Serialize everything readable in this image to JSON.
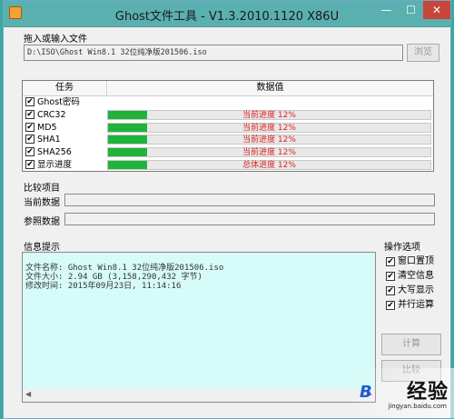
{
  "window": {
    "title": "Ghost文件工具 - V1.3.2010.1120 X86U",
    "min_glyph": "—",
    "max_glyph": "☐",
    "close_glyph": "✕"
  },
  "input_section": {
    "label": "拖入或输入文件",
    "path_value": "D:\\ISO\\Ghost Win8.1 32位纯净版201506.iso",
    "browse_label": "浏览"
  },
  "task_table": {
    "headers": {
      "task": "任务",
      "value": "数据值"
    },
    "rows": [
      {
        "name": "Ghost密码",
        "checked": true,
        "progress_text": "",
        "progress": 0
      },
      {
        "name": "CRC32",
        "checked": true,
        "progress_text": "当前进度 12%",
        "progress": 0.12
      },
      {
        "name": "MD5",
        "checked": true,
        "progress_text": "当前进度 12%",
        "progress": 0.12
      },
      {
        "name": "SHA1",
        "checked": true,
        "progress_text": "当前进度 12%",
        "progress": 0.12
      },
      {
        "name": "SHA256",
        "checked": true,
        "progress_text": "当前进度 12%",
        "progress": 0.12
      },
      {
        "name": "显示进度",
        "checked": true,
        "progress_text": "总体进度 12%",
        "progress": 0.12
      }
    ],
    "check_glyph": "✔",
    "progress_color": "#1fb33a",
    "progress_text_color": "#dd2222"
  },
  "compare_section": {
    "label": "比较项目",
    "current_label": "当前数据",
    "reference_label": "参照数据"
  },
  "info_section": {
    "label": "信息提示",
    "lines": [
      "文件名称: Ghost Win8.1 32位纯净版201506.iso",
      "文件大小: 2.94 GB (3,158,290,432 字节)",
      "修改时间: 2015年09月23日, 11:14:16"
    ],
    "background": "#d6fbf8",
    "scroll_left_glyph": "◀",
    "scroll_right_glyph": "▶"
  },
  "options": {
    "label": "操作选项",
    "items": [
      {
        "label": "窗口置顶",
        "checked": true
      },
      {
        "label": "清空信息",
        "checked": true
      },
      {
        "label": "大写显示",
        "checked": true
      },
      {
        "label": "并行运算",
        "checked": true
      }
    ],
    "calc_label": "计算",
    "compare_label": "比较"
  },
  "watermark": {
    "text": "经验",
    "url": "jingyan.baidu.com",
    "logo_glyph": "B"
  }
}
